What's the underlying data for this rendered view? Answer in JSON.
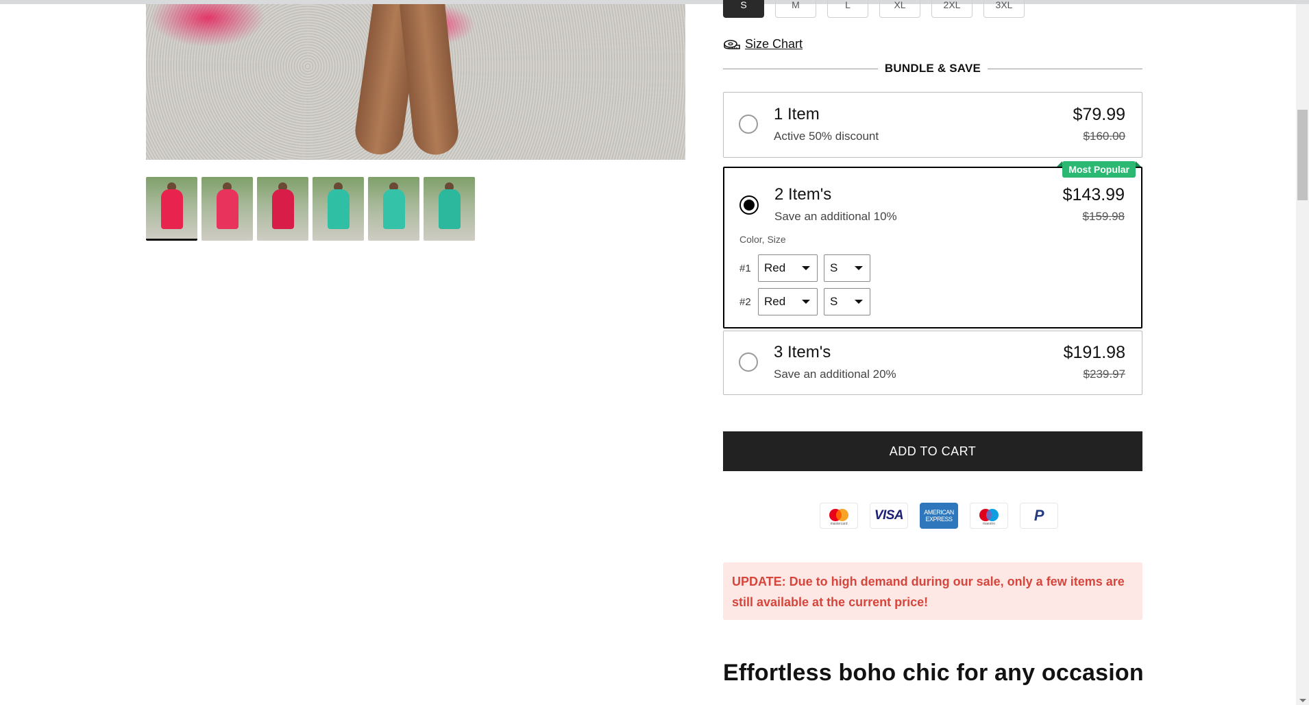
{
  "sizes": {
    "options": [
      "S",
      "M",
      "L",
      "XL",
      "2XL",
      "3XL"
    ],
    "selected": "S"
  },
  "size_chart": {
    "label": "Size Chart",
    "icon": "ruler-icon"
  },
  "bundle": {
    "header": "BUNDLE & SAVE",
    "options": [
      {
        "title": "1 Item",
        "subtitle": "Active 50% discount",
        "price": "$79.99",
        "old_price": "$160.00",
        "selected": false
      },
      {
        "title": "2 Item's",
        "subtitle": "Save an additional 10%",
        "price": "$143.99",
        "old_price": "$159.98",
        "selected": true,
        "badge": "Most Popular",
        "variant_label": "Color, Size",
        "variants": [
          {
            "num": "#1",
            "color": "Red",
            "size": "S"
          },
          {
            "num": "#2",
            "color": "Red",
            "size": "S"
          }
        ]
      },
      {
        "title": "3 Item's",
        "subtitle": "Save an additional 20%",
        "price": "$191.98",
        "old_price": "$239.97",
        "selected": false
      }
    ]
  },
  "add_to_cart": "ADD TO CART",
  "payments": [
    {
      "name": "mastercard",
      "label": "mastercard"
    },
    {
      "name": "visa",
      "label": "VISA"
    },
    {
      "name": "amex",
      "label": "AMERICAN EXPRESS"
    },
    {
      "name": "maestro",
      "label": "maestro"
    },
    {
      "name": "paypal",
      "label": "P"
    }
  ],
  "notice": "UPDATE: Due to high demand during our sale, only a few items are still available at the current price!",
  "headline": "Effortless boho chic for any occasion",
  "gallery": {
    "thumbnail_colors": [
      "#e8244e",
      "#e8335c",
      "#d81e48",
      "#2fbfa5",
      "#34c2a8",
      "#2bb89d"
    ],
    "active_index": 0
  },
  "colors": {
    "accent_green": "#2ab873",
    "notice_text": "#d6453b",
    "notice_bg": "#fde8e6",
    "button_bg": "#222222"
  }
}
